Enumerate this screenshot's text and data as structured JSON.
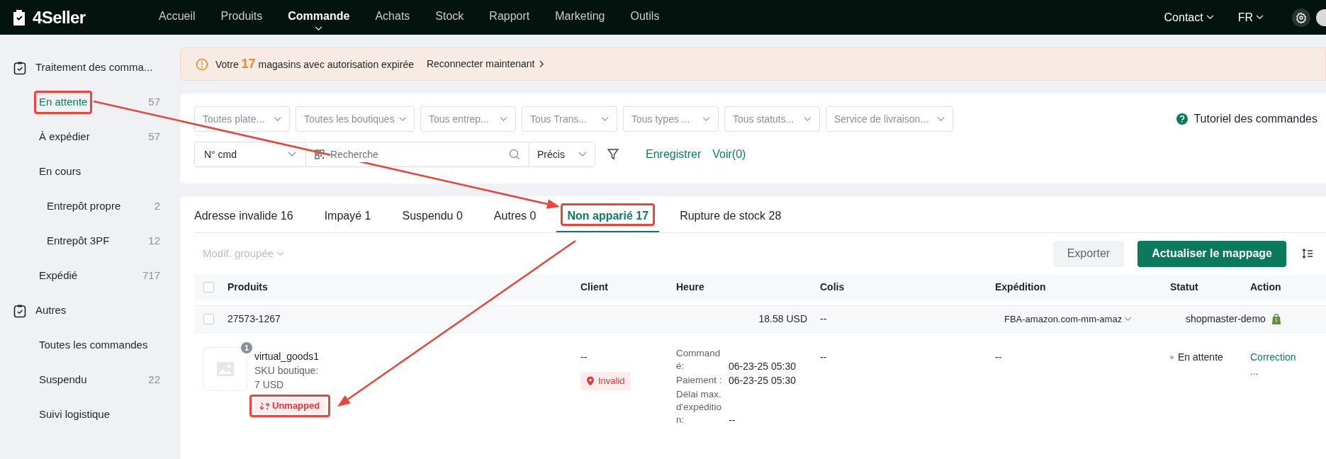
{
  "nav": {
    "logo": "4Seller",
    "items": [
      {
        "label": "Accueil",
        "selected": false
      },
      {
        "label": "Produits",
        "selected": false
      },
      {
        "label": "Commande",
        "selected": true
      },
      {
        "label": "Achats",
        "selected": false
      },
      {
        "label": "Stock",
        "selected": false
      },
      {
        "label": "Rapport",
        "selected": false
      },
      {
        "label": "Marketing",
        "selected": false
      },
      {
        "label": "Outils",
        "selected": false
      }
    ],
    "contact": "Contact",
    "language": "FR"
  },
  "sidebar": {
    "groups": [
      {
        "title": "Traitement des comma...",
        "items": [
          {
            "label": "En attente",
            "count": "57",
            "selected": true,
            "highlighted": true
          },
          {
            "label": "À expédier",
            "count": "57",
            "selected": false,
            "highlighted": false
          },
          {
            "label": "En cours",
            "selected": false,
            "highlighted": false,
            "children": [
              {
                "label": "Entrepôt propre",
                "count": "2",
                "selected": false,
                "highlighted": false
              },
              {
                "label": "Entrepôt 3PF",
                "count": "12",
                "selected": false,
                "highlighted": false
              }
            ]
          },
          {
            "label": "Expédié",
            "count": "717",
            "selected": false,
            "highlighted": false
          }
        ]
      },
      {
        "title": "Autres",
        "items": [
          {
            "label": "Toutes les commandes",
            "selected": false,
            "highlighted": false
          },
          {
            "label": "Suspendu",
            "count": "22",
            "selected": false,
            "highlighted": false
          },
          {
            "label": "Suivi logistique",
            "selected": false,
            "highlighted": false
          }
        ]
      }
    ]
  },
  "banner": {
    "prefix": "Votre",
    "count": "17",
    "suffix": "magasins avec autorisation expirée",
    "link": "Reconnecter maintenant"
  },
  "filters": {
    "dropdowns": [
      {
        "placeholder": "Toutes plate..."
      },
      {
        "placeholder": "Toutes les boutiques"
      },
      {
        "placeholder": "Tous entrep..."
      },
      {
        "placeholder": "Tous Trans..."
      },
      {
        "placeholder": "Tous types ..."
      },
      {
        "placeholder": "Tous statuts..."
      },
      {
        "placeholder": "Service de livraison..."
      }
    ],
    "tutorial": "Tutoriel des commandes",
    "search_type": "N° cmd",
    "search": {
      "placeholder": "Recherche"
    },
    "match": "Précis",
    "save": "Enregistrer",
    "view": "Voir(0)"
  },
  "tabs": [
    {
      "label": "Adresse invalide 16",
      "selected": false,
      "highlighted": false
    },
    {
      "label": "Impayé 1",
      "selected": false,
      "highlighted": false
    },
    {
      "label": "Suspendu 0",
      "selected": false,
      "highlighted": false
    },
    {
      "label": "Autres 0",
      "selected": false,
      "highlighted": false
    },
    {
      "label": "Non apparié 17",
      "selected": true,
      "highlighted": true
    },
    {
      "label": "Rupture de stock 28",
      "selected": false,
      "highlighted": false
    }
  ],
  "toolbar": {
    "bulk_edit": {
      "label": "Modif. groupée",
      "disabled": true
    },
    "export": "Exporter",
    "update": "Actualiser le mappage"
  },
  "table": {
    "checked": false,
    "columns": [
      "Produits",
      "Client",
      "Heure",
      "Colis",
      "Expédition",
      "Statut",
      "Action"
    ],
    "orders": [
      {
        "checked": false,
        "order_no": "27573-1267",
        "amount": "18.58 USD",
        "package": "--",
        "shipping": "FBA-amazon.com-mm-amaz",
        "store": "shopmaster-demo",
        "items": [
          {
            "name": "virtual_goods1",
            "quantity": "1",
            "sku_label": "SKU boutique:",
            "price": "7 USD",
            "mapping": "Unmapped",
            "mapping_highlighted": true,
            "client": "--",
            "address_status": "Invalid",
            "times": [
              {
                "label": "Commandé:",
                "value": "06-23-25 05:30"
              },
              {
                "label": "Paiement :",
                "value": "06-23-25 05:30"
              },
              {
                "label": "Délai max. d'expédition:",
                "value": "--"
              }
            ],
            "package": "--",
            "shipping": "--",
            "status": "En attente",
            "actions": [
              "Correction",
              "..."
            ]
          }
        ]
      }
    ]
  }
}
